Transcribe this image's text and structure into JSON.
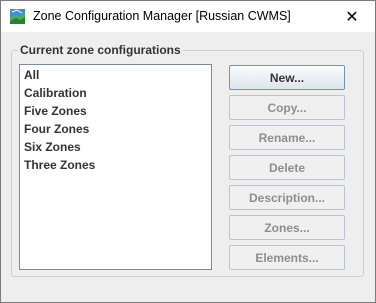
{
  "window": {
    "title": "Zone Configuration Manager [Russian CWMS]",
    "close_glyph": "✕"
  },
  "group": {
    "legend": "Current zone configurations"
  },
  "list": {
    "items": [
      "All",
      "Calibration",
      "Five Zones",
      "Four Zones",
      "Six Zones",
      "Three Zones"
    ]
  },
  "buttons": {
    "new_label": "New...",
    "copy_label": "Copy...",
    "rename_label": "Rename...",
    "delete_label": "Delete",
    "description_label": "Description...",
    "zones_label": "Zones...",
    "elements_label": "Elements..."
  },
  "colors": {
    "window_bg": "#eeeeee",
    "group_border": "#c4d0de",
    "disabled_text": "#8e8e8e",
    "enabled_text": "#333333"
  },
  "icons": {
    "app": "map-icon",
    "close": "close-icon"
  }
}
